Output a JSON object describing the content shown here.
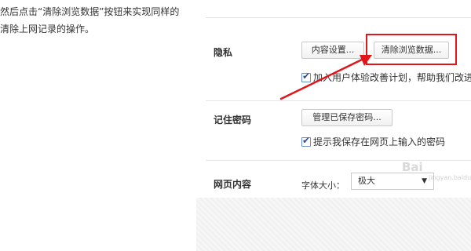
{
  "caption": {
    "line1": "然后点击“清除浏览数据”按钮来实现同样的",
    "line2": "清除上网记录的操作。"
  },
  "privacy": {
    "label": "隐私",
    "content_settings_button": "内容设置...",
    "clear_data_button": "清除浏览数据...",
    "improve_checkbox_label": "加入用户体验改善计划，帮助我们改进产",
    "improve_checked": true
  },
  "passwords": {
    "label": "记住密码",
    "manage_button": "管理已保存密码...",
    "remember_checkbox_label": "提示我保存在网页上输入的密码",
    "remember_checked": true
  },
  "web_content": {
    "label": "网页内容",
    "font_size_label": "字体大小：",
    "font_size_value": "极大"
  },
  "annotation": {
    "highlight_color": "#e0161b"
  },
  "watermark": {
    "text": "Bai",
    "sub": "jingyan.baidu.com"
  }
}
